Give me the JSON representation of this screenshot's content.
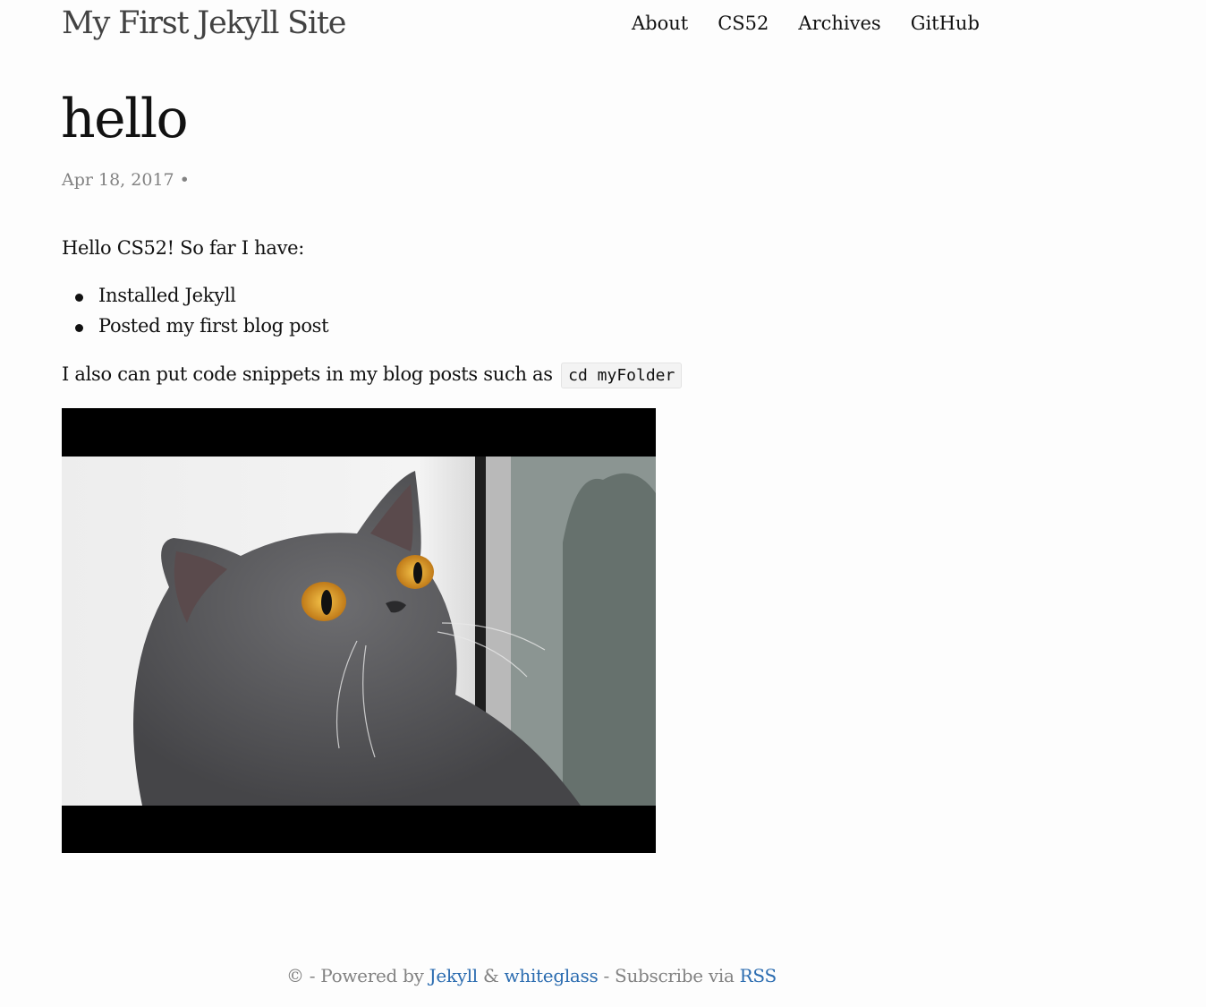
{
  "header": {
    "site_title": "My First Jekyll Site",
    "nav": [
      {
        "label": "About"
      },
      {
        "label": "CS52"
      },
      {
        "label": "Archives"
      },
      {
        "label": "GitHub"
      }
    ]
  },
  "post": {
    "title": "hello",
    "meta": "Apr 18, 2017 •",
    "intro": "Hello CS52! So far I have:",
    "list_items": [
      "Installed Jekyll",
      "Posted my first blog post"
    ],
    "code_sentence": "I also can put code snippets in my blog posts such as",
    "code_snippet": "cd myFolder",
    "image_alt": "surprised grey cat"
  },
  "footer": {
    "prefix": "© - Powered by",
    "jekyll_link": "Jekyll",
    "amp": "&",
    "whiteglass_link": "whiteglass",
    "subscribe": "- Subscribe via",
    "rss_link": "RSS"
  },
  "colors": {
    "link": "#2b6cb0",
    "meta_text": "#828282",
    "background": "#fdfdfd"
  }
}
